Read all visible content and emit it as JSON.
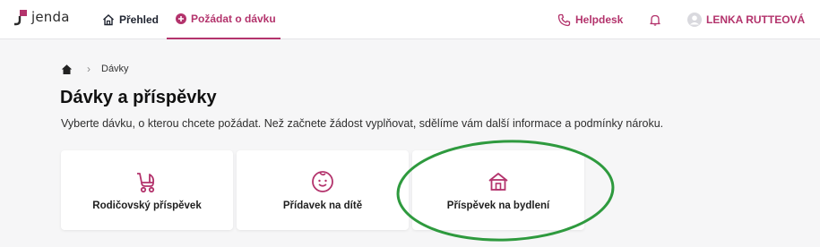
{
  "app": {
    "logo_text": "jenda"
  },
  "nav": {
    "overview_label": "Přehled",
    "request_label": "Požádat o dávku",
    "helpdesk_label": "Helpdesk",
    "user_name": "LENKA RUTTEOVÁ"
  },
  "breadcrumb": {
    "current": "Dávky"
  },
  "page": {
    "title": "Dávky a příspěvky",
    "description": "Vyberte dávku, o kterou chcete požádat. Než začnete žádost vyplňovat, sdělíme vám další informace a podmínky nároku."
  },
  "cards": [
    {
      "label": "Rodičovský příspěvek",
      "icon": "stroller-icon"
    },
    {
      "label": "Přídavek na dítě",
      "icon": "child-face-icon"
    },
    {
      "label": "Příspěvek na bydlení",
      "icon": "house-icon"
    }
  ],
  "colors": {
    "accent": "#b3336c",
    "highlight": "#2e9a3e",
    "background": "#f6f6f7"
  }
}
